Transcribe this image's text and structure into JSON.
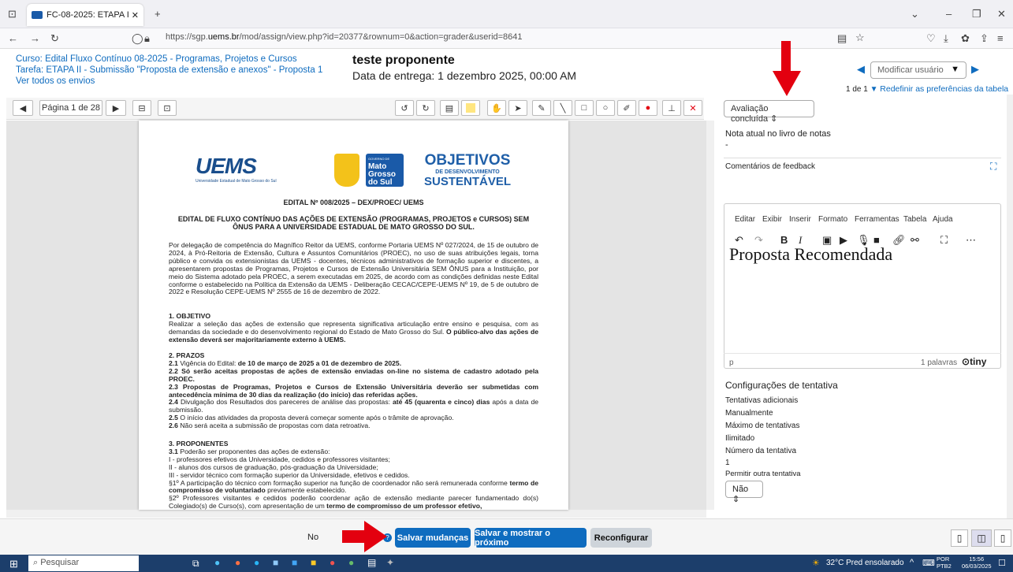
{
  "browser": {
    "tab_title": "FC-08-2025: ETAPA II - Submiss",
    "url_prefix": "https://sgp.",
    "url_host": "uems.br",
    "url_rest": "/mod/assign/view.php?id=20377&rownum=0&action=grader&userid=8641"
  },
  "header": {
    "course": "Curso: Edital Fluxo Contínuo 08-2025 - Programas, Projetos e Cursos",
    "task": "Tarefa: ETAPA II - Submissão \"Proposta de extensão e anexos\" - Proposta 1",
    "view_all": "Ver todos os envios",
    "user_name": "teste proponente",
    "due_date": "Data de entrega: 1 dezembro 2025, 00:00 AM",
    "change_user": "Modificar usuário",
    "count": "1 de 1",
    "reset_prefs": "Redefinir as preferências da tabela"
  },
  "pdf": {
    "page_label": "Página 1 de 28",
    "logo_uems": "UEMS",
    "logo_uems_sub": "Universidade Estadual de Mato Grosso do Sul",
    "logo_gov_1": "GOVERNO DE",
    "logo_gov_2": "Mato",
    "logo_gov_3": "Grosso",
    "logo_gov_4": "do Sul",
    "logo_ods_1": "OBJETIVOS",
    "logo_ods_2": "DE DESENVOLVIMENTO",
    "logo_ods_3": "SUSTENTÁVEL",
    "edital": "EDITAL Nº 008/2025 – DEX/PROEC/ UEMS",
    "heading": "EDITAL DE FLUXO CONTÍNUO DAS AÇÕES DE EXTENSÃO (PROGRAMAS, PROJETOS e CURSOS) SEM ÔNUS PARA A UNIVERSIDADE ESTADUAL DE MATO GROSSO DO SUL.",
    "para1": "Por delegação de competência do Magnífico Reitor da UEMS, conforme Portaria UEMS Nº 027/2024, de 15 de outubro de 2024, à Pró-Reitoria de Extensão, Cultura e Assuntos Comunitários (PROEC), no uso de suas atribuições legais, torna público e convida os extensionistas da UEMS - docentes, técnicos administrativos de formação superior e discentes, a apresentarem propostas de Programas, Projetos e Cursos de Extensão Universitária SEM ÔNUS para a Instituição, por meio do Sistema adotado pela PROEC, a serem executadas em 2025, de acordo com as condições definidas neste Edital conforme o estabelecido na Política da Extensão da UEMS - Deliberação CECAC/CEPE-UEMS Nº 19, de 5 de outubro de 2022 e Resolução CEPE-UEMS Nº 2555 de 16 de dezembro de 2022.",
    "s1_title": "1. OBJETIVO",
    "s1_text": "Realizar a seleção das ações de extensão que representa significativa articulação entre ensino e pesquisa, com as demandas da sociedade e do desenvolvimento regional do Estado de Mato Grosso do Sul.",
    "s1_bold": "O público-alvo das ações de extensão deverá ser majoritariamente externo à UEMS.",
    "s2_title": "2. PRAZOS",
    "s2_l1a": "2.1",
    "s2_l1b": " Vigência do Edital: ",
    "s2_l1c": "de 10 de março de 2025 a 01 de dezembro de 2025.",
    "s2_l2": "2.2 Só serão aceitas propostas de ações de extensão enviadas on-line no sistema de cadastro adotado pela PROEC.",
    "s2_l3": "2.3 Propostas de Programas, Projetos e Cursos de Extensão Universitária deverão ser submetidas com antecedência mínima de 30 dias da realização (do início) das referidas ações.",
    "s2_l4a": "2.4",
    "s2_l4b": " Divulgação dos Resultados dos pareceres de análise das propostas: ",
    "s2_l4c": "até 45 (quarenta e cinco) dias",
    "s2_l4d": " após a data de submissão.",
    "s2_l5a": "2.5",
    "s2_l5b": " O início das atividades da proposta deverá começar somente após o trâmite de aprovação.",
    "s2_l6a": "2.6",
    "s2_l6b": " Não será aceita a submissão de propostas com data retroativa.",
    "s3_title": "3. PROPONENTES",
    "s3_l1a": "3.1",
    "s3_l1b": " Poderão ser proponentes das ações de extensão:",
    "s3_l2": "I - professores efetivos da Universidade, cedidos e professores visitantes;",
    "s3_l3": "II - alunos dos cursos de graduação, pós-graduação da Universidade;",
    "s3_l4": "III - servidor técnico com formação superior da Universidade, efetivos e cedidos.",
    "s3_l5a": "§1º A participação do técnico com formação superior na função de coordenador não será remunerada conforme ",
    "s3_l5b": "termo de compromisso de voluntariado",
    "s3_l5c": " previamente estabelecido.",
    "s3_l6a": "§2º Professores visitantes e cedidos poderão coordenar ação de extensão mediante parecer fundamentado do(s) Colegiado(s) de Curso(s), com apresentação de um ",
    "s3_l6b": "termo de compromisso de um professor efetivo,"
  },
  "panel": {
    "status": "Avaliação concluída",
    "grade_label": "Nota atual no livro de notas",
    "grade_value": "-",
    "feedback_label": "Comentários de feedback",
    "menu": [
      "Editar",
      "Exibir",
      "Inserir",
      "Formato",
      "Ferramentas",
      "Tabela",
      "Ajuda"
    ],
    "content": "Proposta Recomendada",
    "path": "p",
    "words": "1 palavras",
    "tiny": "tiny",
    "attempt_title": "Configurações de tentativa",
    "extra_attempts_label": "Tentativas adicionais",
    "extra_attempts_value": "Manualmente",
    "max_attempts_label": "Máximo de tentativas",
    "max_attempts_value": "Ilimitado",
    "attempt_no_label": "Número da tentativa",
    "attempt_no_value": "1",
    "allow_label": "Permitir outra tentativa",
    "allow_value": "Não"
  },
  "bottom": {
    "notify": "No",
    "save": "Salvar mudanças",
    "save_next": "Salvar e mostrar o próximo",
    "reset": "Reconfigurar"
  },
  "taskbar": {
    "search": "Pesquisar",
    "weather": "32°C  Pred ensolarado",
    "lang1": "POR",
    "lang2": "PTB2",
    "time": "15:56",
    "date": "06/03/2025"
  },
  "colors": {
    "accent": "#0f6cbf",
    "arrow": "#e3000f",
    "taskbar": "#1c3e6b"
  }
}
